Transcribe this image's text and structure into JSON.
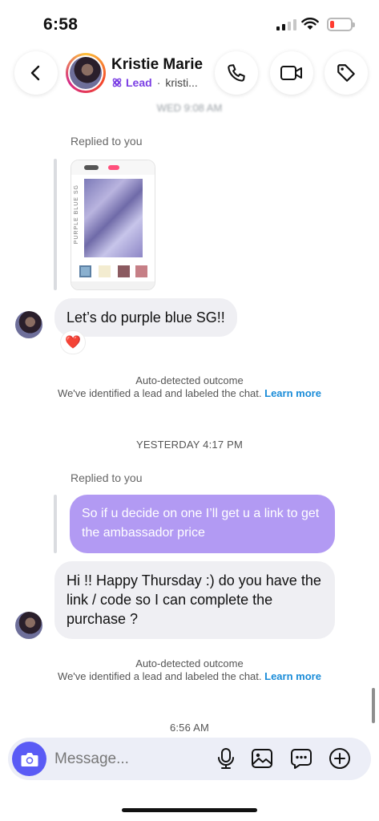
{
  "status_bar": {
    "time": "6:58"
  },
  "header": {
    "contact_name": "Kristie Marie",
    "label": "Lead",
    "separator": "·",
    "username": "kristi...",
    "icons": {
      "back": "chevron-left-icon",
      "call": "phone-icon",
      "video": "video-camera-icon",
      "tag": "tag-icon",
      "label": "lead-badge-icon"
    }
  },
  "conversation": {
    "blurred_timestamp": "WED 9:08 AM",
    "reply_1": {
      "label": "Replied to you",
      "card_vertical_text": "PURPLE BLUE SG"
    },
    "message_1": {
      "text": "Let’s do purple blue SG!!",
      "reaction": "❤️"
    },
    "system_1": {
      "title": "Auto-detected outcome",
      "body": "We've identified a lead and labeled the chat.",
      "link": "Learn more"
    },
    "timestamp_1": "YESTERDAY 4:17 PM",
    "reply_2": {
      "label": "Replied to you",
      "quoted_text": "So if u decide on one I’ll get u a link to get the ambassador price"
    },
    "message_2": {
      "text": "Hi !! Happy Thursday :) do you have the link / code so I can complete the purchase ?"
    },
    "system_2": {
      "title": "Auto-detected outcome",
      "body": "We've identified a lead and labeled the chat.",
      "link": "Learn more"
    },
    "timestamp_2": "6:56 AM"
  },
  "composer": {
    "placeholder": "Message...",
    "icons": [
      "camera-icon",
      "microphone-icon",
      "image-icon",
      "sticker-icon",
      "plus-icon"
    ]
  },
  "colors": {
    "accent_purple": "#7b3fe4",
    "outgoing_bubble": "#b29af3",
    "incoming_bubble": "#efeff3",
    "camera_button": "#5a5bf5",
    "link_blue": "#1a8cd8"
  }
}
